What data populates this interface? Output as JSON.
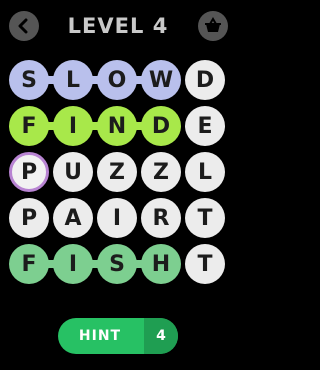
{
  "header": {
    "title": "LEVEL 4",
    "back_icon": "chevron-left-icon",
    "shop_icon": "basket-icon"
  },
  "colors": {
    "found_word_1": "#b9c0ec",
    "found_word_2": "#a8e84a",
    "found_word_3": "#7dcf90",
    "selected_outline": "#b884d2",
    "cell": "#ececec",
    "hint": "#27c164"
  },
  "grid": {
    "rows": [
      {
        "letters": [
          "S",
          "L",
          "O",
          "W",
          "D"
        ],
        "highlight": "found_word_1",
        "highlight_cols": [
          0,
          1,
          2,
          3
        ]
      },
      {
        "letters": [
          "F",
          "I",
          "N",
          "D",
          "E"
        ],
        "highlight": "found_word_2",
        "highlight_cols": [
          0,
          1,
          2,
          3
        ]
      },
      {
        "letters": [
          "P",
          "U",
          "Z",
          "Z",
          "L"
        ],
        "highlight": null,
        "selected_col": 0
      },
      {
        "letters": [
          "P",
          "A",
          "I",
          "R",
          "T"
        ],
        "highlight": null
      },
      {
        "letters": [
          "F",
          "I",
          "S",
          "H",
          "T"
        ],
        "highlight": "found_word_3",
        "highlight_cols": [
          0,
          1,
          2,
          3
        ]
      }
    ]
  },
  "hint": {
    "label": "HINT",
    "count": "4"
  }
}
